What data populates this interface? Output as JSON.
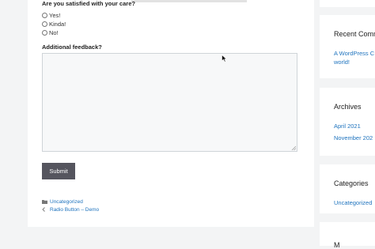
{
  "form": {
    "question": "Are you satisfied with your care?",
    "options": [
      "Yes!",
      "Kinda!",
      "No!"
    ],
    "feedback_label": "Additional feedback?",
    "feedback_value": "",
    "submit_label": "Submit"
  },
  "post_meta": {
    "category": "Uncategorized",
    "prev_post": "Radio Button – Demo"
  },
  "sidebar": {
    "recent_comments": {
      "title": "Recent Comm",
      "line1": "A WordPress C",
      "line2": "world!"
    },
    "archives": {
      "title": "Archives",
      "items": [
        "April 2021",
        "November 202"
      ]
    },
    "categories": {
      "title": "Categories",
      "items": [
        "Uncategorized"
      ]
    },
    "meta_partial": "M"
  },
  "colors": {
    "link": "#1e73be",
    "button": "#55555e",
    "page_bg": "#f3f4f5"
  }
}
